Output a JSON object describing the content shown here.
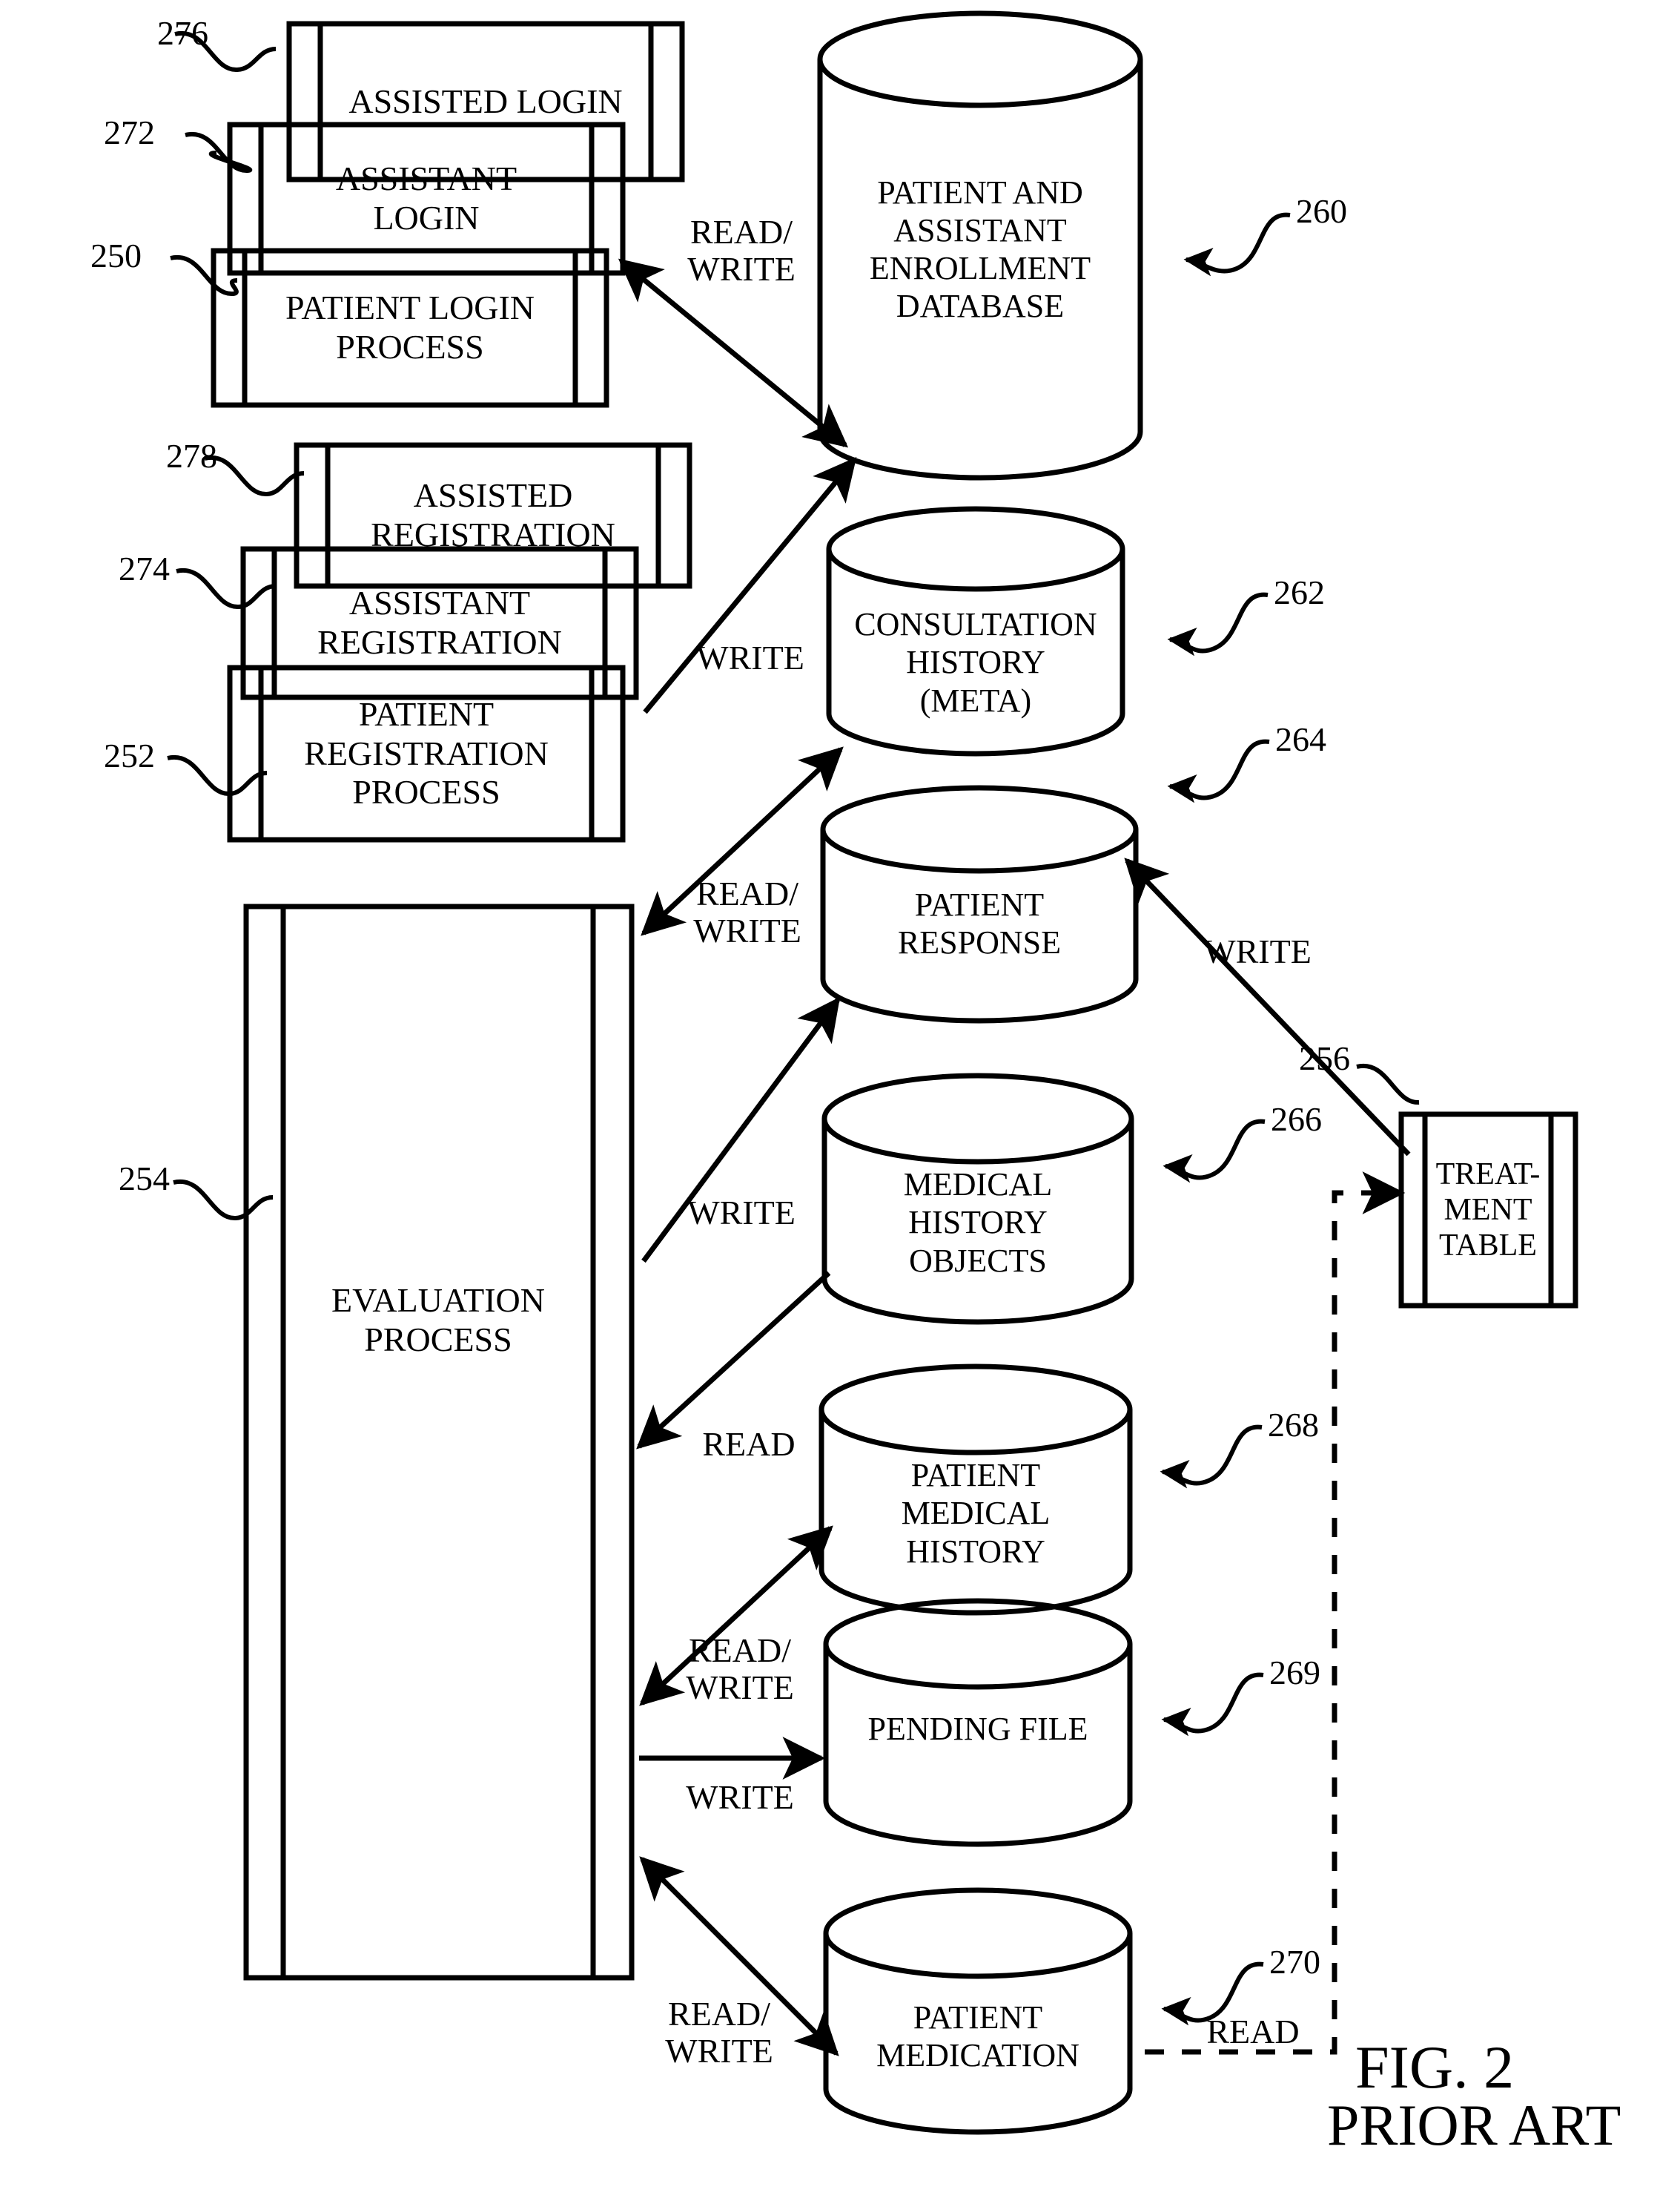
{
  "figure": {
    "caption_line1": "FIG. 2",
    "caption_line2": "PRIOR ART"
  },
  "processes": [
    {
      "ref": "276",
      "label": "ASSISTED LOGIN"
    },
    {
      "ref": "272",
      "label": "ASSISTANT\nLOGIN"
    },
    {
      "ref": "250",
      "label": "PATIENT LOGIN\nPROCESS"
    },
    {
      "ref": "278",
      "label": "ASSISTED\nREGISTRATION"
    },
    {
      "ref": "274",
      "label": "ASSISTANT\nREGISTRATION"
    },
    {
      "ref": "252",
      "label": "PATIENT\nREGISTRATION\nPROCESS"
    },
    {
      "ref": "254",
      "label": "EVALUATION\nPROCESS"
    },
    {
      "ref": "256",
      "label": "TREAT-\nMENT\nTABLE"
    }
  ],
  "datastores": [
    {
      "ref": "260",
      "label": "PATIENT AND\nASSISTANT\nENROLLMENT\nDATABASE"
    },
    {
      "ref": "262",
      "label": "CONSULTATION\nHISTORY\n(META)"
    },
    {
      "ref": "264",
      "label": "PATIENT\nRESPONSE"
    },
    {
      "ref": "266",
      "label": "MEDICAL\nHISTORY\nOBJECTS"
    },
    {
      "ref": "268",
      "label": "PATIENT\nMEDICAL\nHISTORY"
    },
    {
      "ref": "269",
      "label": "PENDING FILE"
    },
    {
      "ref": "270",
      "label": "PATIENT\nMEDICATION"
    }
  ],
  "flows": [
    {
      "id": "f1",
      "label": "READ/\nWRITE",
      "from": "250",
      "to": "260"
    },
    {
      "id": "f2",
      "label": "WRITE",
      "from": "252",
      "to": "260"
    },
    {
      "id": "f3",
      "label": "READ/\nWRITE",
      "from": "254",
      "to": "262"
    },
    {
      "id": "f4",
      "label": "WRITE",
      "from": "254",
      "to": "264"
    },
    {
      "id": "f5",
      "label": "WRITE",
      "from": "256",
      "to": "264"
    },
    {
      "id": "f6",
      "label": "READ",
      "from": "266",
      "to": "254"
    },
    {
      "id": "f7",
      "label": "READ/\nWRITE",
      "from": "254",
      "to": "268"
    },
    {
      "id": "f8",
      "label": "WRITE",
      "from": "254",
      "to": "269"
    },
    {
      "id": "f9",
      "label": "READ/\nWRITE",
      "from": "254",
      "to": "270"
    },
    {
      "id": "f10",
      "label": "READ",
      "from": "270",
      "to": "256"
    }
  ],
  "colors": {
    "ink": "#000000",
    "paper": "#ffffff"
  }
}
